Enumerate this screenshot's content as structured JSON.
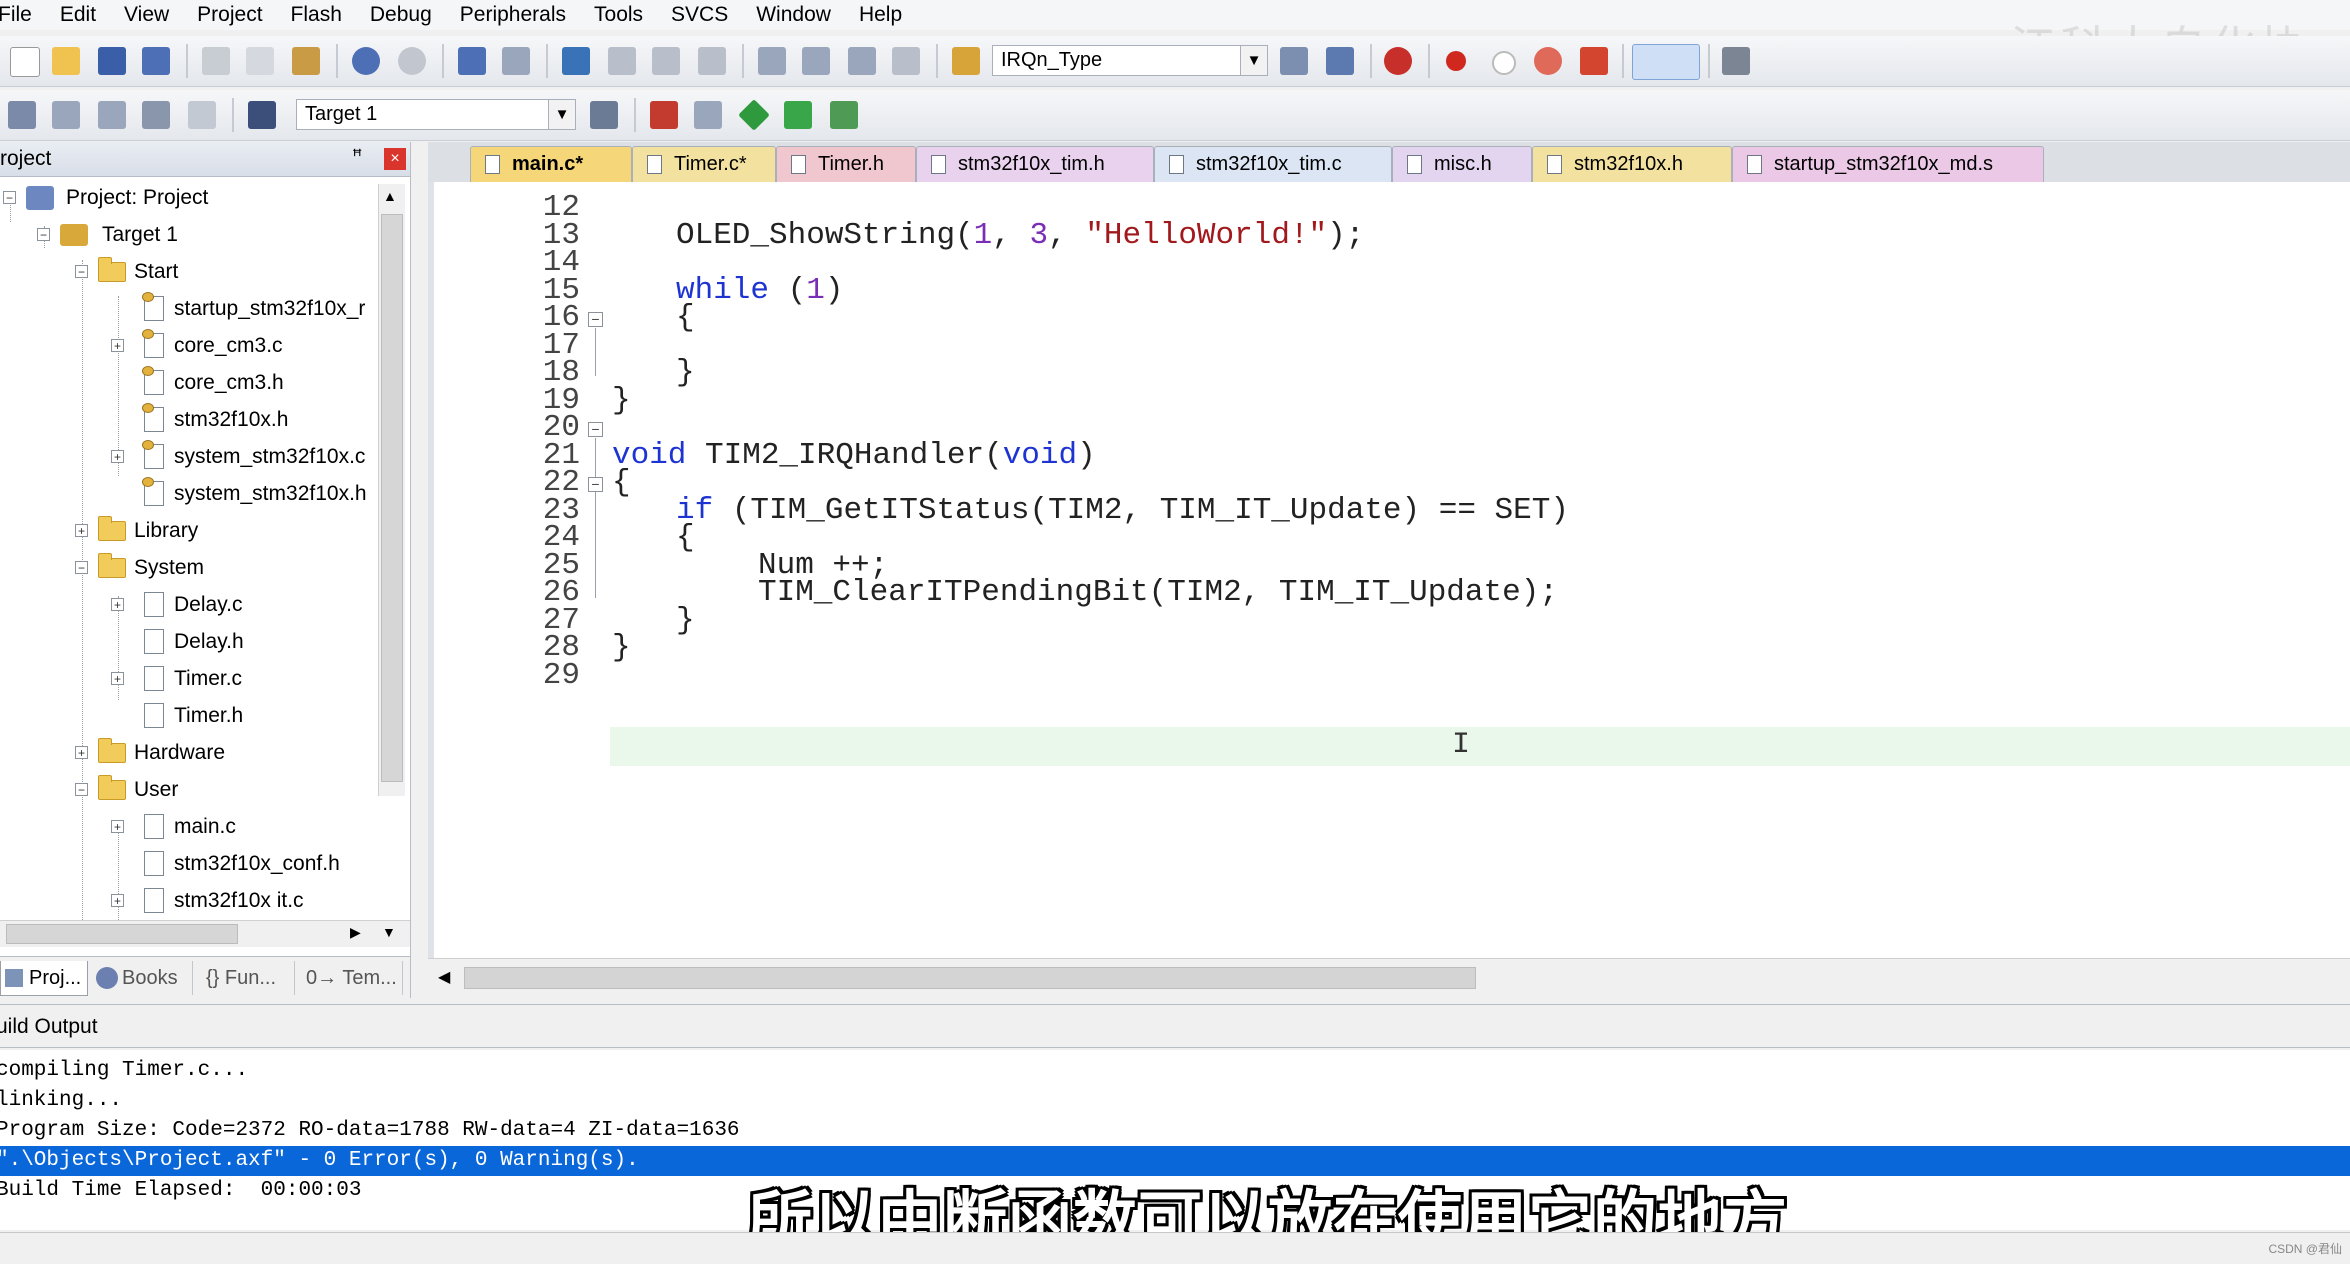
{
  "menu": [
    "File",
    "Edit",
    "View",
    "Project",
    "Flash",
    "Debug",
    "Peripherals",
    "Tools",
    "SVCS",
    "Window",
    "Help"
  ],
  "watermark": "江科大自化协",
  "toolbar": {
    "find_combo": "IRQn_Type",
    "target_combo": "Target 1"
  },
  "project_panel": {
    "title": "roject",
    "pin": "ꟸ",
    "close": "×",
    "tree": [
      {
        "label": "Project: Project"
      },
      {
        "label": "Target 1"
      },
      {
        "label": "Start"
      },
      {
        "label": "startup_stm32f10x_r"
      },
      {
        "label": "core_cm3.c"
      },
      {
        "label": "core_cm3.h"
      },
      {
        "label": "stm32f10x.h"
      },
      {
        "label": "system_stm32f10x.c"
      },
      {
        "label": "system_stm32f10x.h"
      },
      {
        "label": "Library"
      },
      {
        "label": "System"
      },
      {
        "label": "Delay.c"
      },
      {
        "label": "Delay.h"
      },
      {
        "label": "Timer.c"
      },
      {
        "label": "Timer.h"
      },
      {
        "label": "Hardware"
      },
      {
        "label": "User"
      },
      {
        "label": "main.c"
      },
      {
        "label": "stm32f10x_conf.h"
      },
      {
        "label": "stm32f10x it.c"
      }
    ],
    "tabs": [
      "Proj...",
      "Books",
      "{} Fun...",
      "0→ Tem..."
    ]
  },
  "editor_tabs": [
    "main.c*",
    "Timer.c*",
    "Timer.h",
    "stm32f10x_tim.h",
    "stm32f10x_tim.c",
    "misc.h",
    "stm32f10x.h",
    "startup_stm32f10x_md.s"
  ],
  "code": {
    "line_numbers": [
      "12",
      "13",
      "14",
      "15",
      "16",
      "17",
      "18",
      "19",
      "20",
      "21",
      "22",
      "23",
      "24",
      "25",
      "26",
      "27",
      "28",
      "29"
    ],
    "l13_fn": "OLED_ShowString(",
    "l13_n1": "1",
    "l13_c1": ", ",
    "l13_n2": "3",
    "l13_c2": ", ",
    "l13_str": "\"HelloWorld!\"",
    "l13_end": ");",
    "l15_kw": "while",
    "l15_open": " (",
    "l15_num": "1",
    "l15_close": ")",
    "brace_open": "{",
    "brace_close": "}",
    "l21_kw1": "void",
    "l21_mid": " TIM2_IRQHandler(",
    "l21_kw2": "void",
    "l21_end": ")",
    "l23_kw": "if",
    "l23_rest": " (TIM_GetITStatus(TIM2, TIM_IT_Update) == SET)",
    "l25": "Num ++;",
    "l26": "TIM_ClearITPendingBit(TIM2, TIM_IT_Update);",
    "ibeam": "I"
  },
  "build_output": {
    "title": "uild Output",
    "lines": [
      "compiling Timer.c...",
      "linking...",
      "Program Size: Code=2372 RO-data=1788 RW-data=4 ZI-data=1636",
      "\".\\Objects\\Project.axf\" - 0 Error(s), 0 Warning(s).",
      "Build Time Elapsed:  00:00:03"
    ]
  },
  "subtitle": "所以中断函数可以放在使用它的地方",
  "csdn_mark": "CSDN @君仙"
}
